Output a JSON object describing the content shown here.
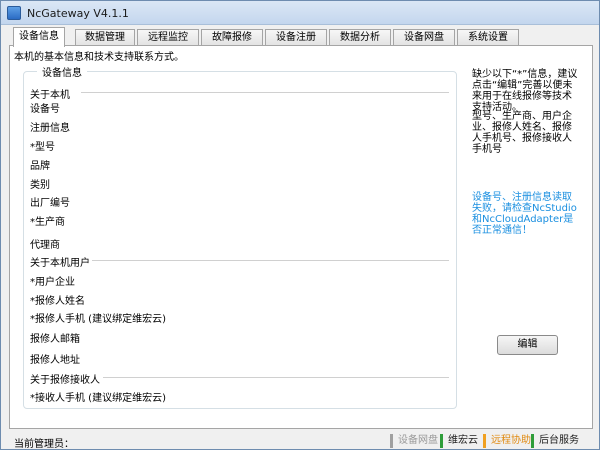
{
  "window": {
    "title": "NcGateway V4.1.1"
  },
  "tabs": [
    {
      "label": "设备信息",
      "active": true
    },
    {
      "label": "数据管理",
      "active": false
    },
    {
      "label": "远程监控",
      "active": false
    },
    {
      "label": "故障报修",
      "active": false
    },
    {
      "label": "设备注册",
      "active": false
    },
    {
      "label": "数据分析",
      "active": false
    },
    {
      "label": "设备网盘",
      "active": false
    },
    {
      "label": "系统设置",
      "active": false
    }
  ],
  "device_info": {
    "intro": "本机的基本信息和技术支持联系方式。",
    "group_title": "设备信息",
    "about_machine": "关于本机",
    "device_no": "设备号",
    "registration": "注册信息",
    "model": "*型号",
    "brand": "品牌",
    "category": "类别",
    "serial": "出厂编号",
    "manufacturer": "*生产商",
    "agent": "代理商",
    "about_user": "关于本机用户",
    "user_company": "*用户企业",
    "repair_name": "*报修人姓名",
    "repair_phone": "*报修人手机 (建议绑定维宏云)",
    "repair_email": "报修人邮箱",
    "repair_address": "报修人地址",
    "about_receiver": "关于报修接收人",
    "receiver_phone": "*接收人手机 (建议绑定维宏云)"
  },
  "hints": {
    "required_note": "缺少以下“*”信息，建议点击“编辑”完善以便未来用于在线报修等技术支持活动。",
    "fill_note": "型号、生产商、用户企业、报修人姓名、报修人手机号、报修接收人手机号",
    "warning": "设备号、注册信息读取失败，请检查NcStudio和NcCloudAdapter是否正常通信！"
  },
  "edit_button": "编辑",
  "status_bar": {
    "admin_label": "当前管理员：",
    "items": [
      {
        "label": "设备网盘",
        "color": "#a0a0a0",
        "text_color": "#9a9a9a"
      },
      {
        "label": "维宏云",
        "color": "#2e9d3a",
        "text_color": "#1f1f1f"
      },
      {
        "label": "远程协助",
        "color": "#f0a020",
        "text_color": "#e08a10"
      },
      {
        "label": "后台服务",
        "color": "#2e9d3a",
        "text_color": "#1f1f1f"
      }
    ]
  }
}
